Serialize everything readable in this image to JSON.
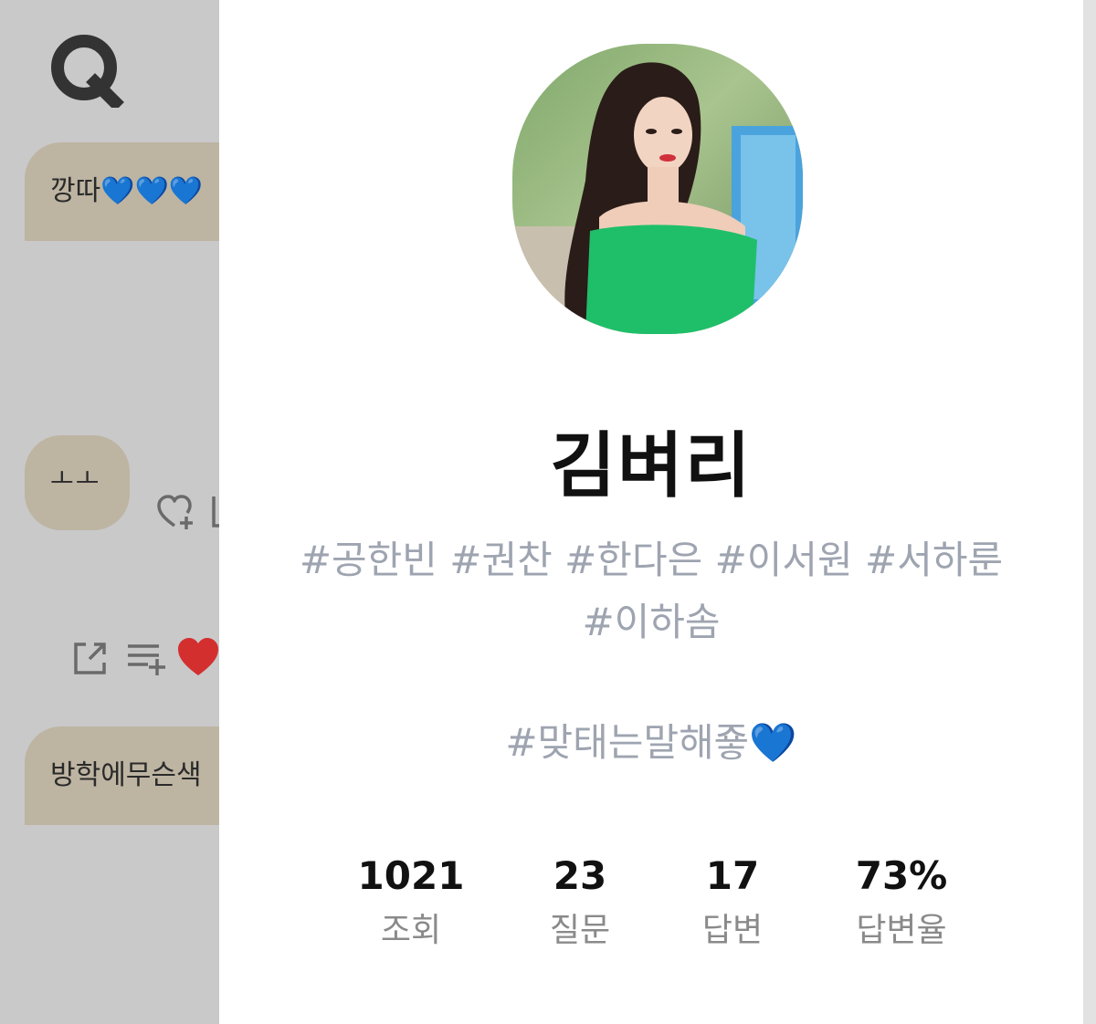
{
  "background_chat": {
    "bubbles": [
      {
        "text": "깡따💙💙💙"
      },
      {
        "text": "ㅗㅗ"
      },
      {
        "text": "방학에무슨색"
      }
    ]
  },
  "profile": {
    "nickname": "김벼리",
    "hashtags_line1": "#공한빈 #권찬 #한다은 #이서원 #서하룬",
    "hashtags_line2": "#이하솜",
    "motto": "#맞태는말해죻💙"
  },
  "stats": {
    "views": {
      "value": "1021",
      "label": "조회"
    },
    "questions": {
      "value": "23",
      "label": "질문"
    },
    "answers": {
      "value": "17",
      "label": "답변"
    },
    "answer_rate": {
      "value": "73%",
      "label": "답변율"
    }
  },
  "colors": {
    "bubble": "#bdb4a2",
    "hashtag": "#9ea4b0",
    "heart": "#d32f2f",
    "avatar_dress": "#1fbf6a"
  },
  "icons": [
    "app-logo-icon",
    "like-add-icon",
    "share-icon",
    "playlist-add-icon",
    "heart-icon"
  ]
}
